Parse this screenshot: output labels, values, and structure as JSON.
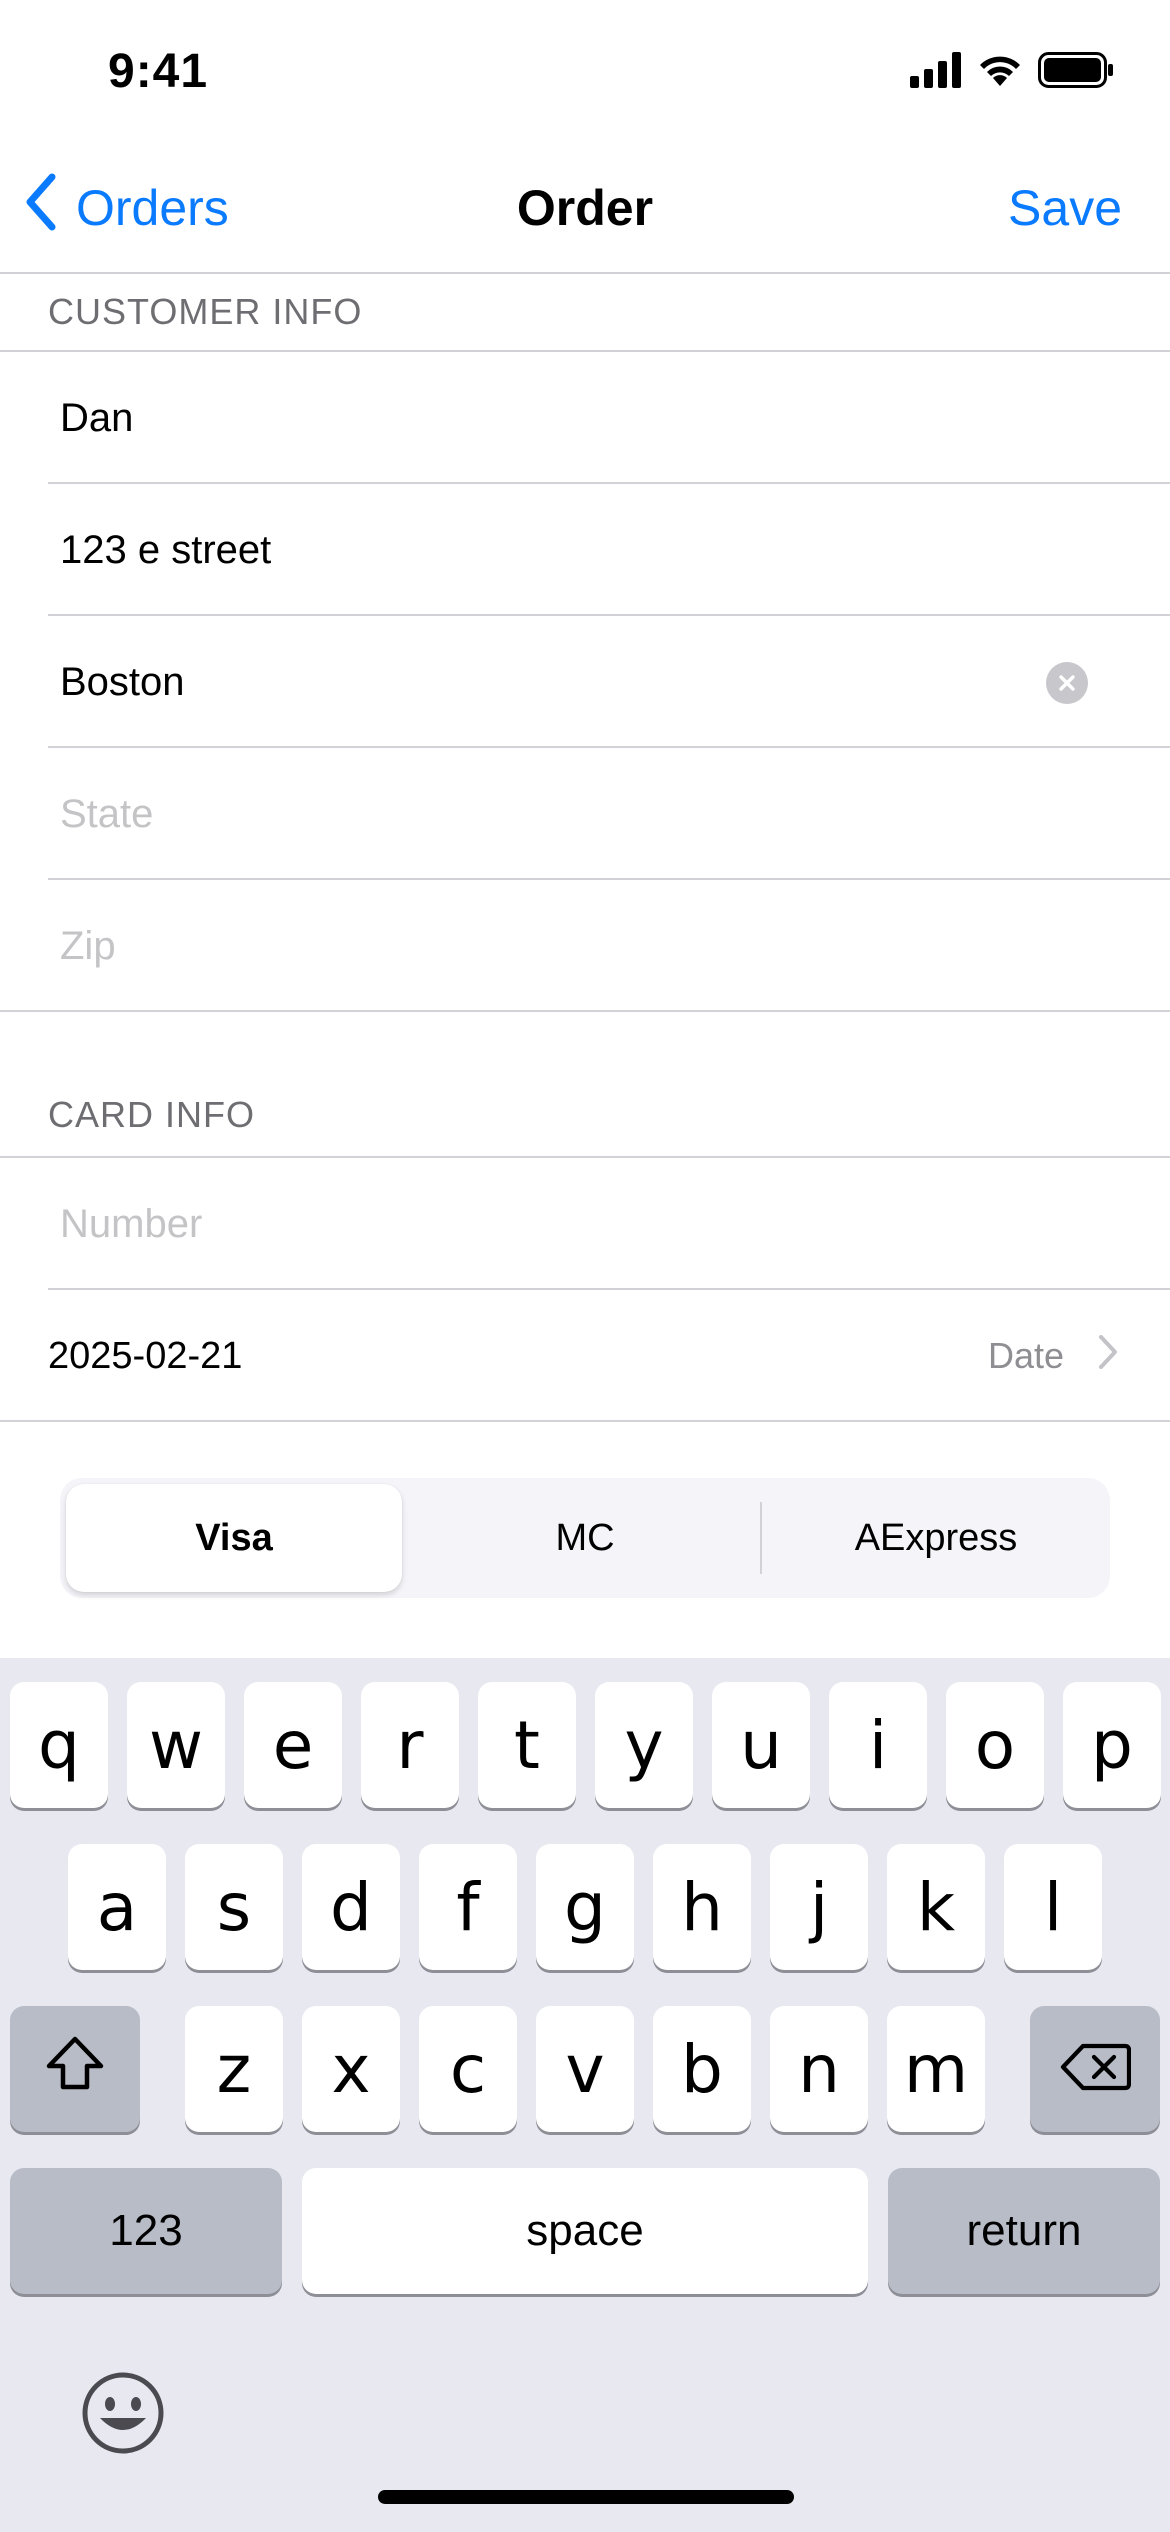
{
  "status_bar": {
    "time": "9:41",
    "icons": [
      "cellular-signal-icon",
      "wifi-icon",
      "battery-icon"
    ]
  },
  "nav": {
    "back_label": "Orders",
    "title": "Order",
    "save_label": "Save"
  },
  "customer_info": {
    "header": "CUSTOMER INFO",
    "name_value": "Dan",
    "address_value": "123 e street",
    "city_value": "Boston",
    "state_placeholder": "State",
    "zip_placeholder": "Zip"
  },
  "card_info": {
    "header": "CARD INFO",
    "number_placeholder": "Number",
    "date_value": "2025-02-21",
    "date_label": "Date"
  },
  "card_type": {
    "options": [
      "Visa",
      "MC",
      "AExpress"
    ],
    "selected": "Visa"
  },
  "keyboard": {
    "row1": [
      "q",
      "w",
      "e",
      "r",
      "t",
      "y",
      "u",
      "i",
      "o",
      "p"
    ],
    "row2": [
      "a",
      "s",
      "d",
      "f",
      "g",
      "h",
      "j",
      "k",
      "l"
    ],
    "row3": [
      "z",
      "x",
      "c",
      "v",
      "b",
      "n",
      "m"
    ],
    "numbers_label": "123",
    "space_label": "space",
    "return_label": "return"
  },
  "colors": {
    "accent": "#0a7aff",
    "separator": "#d1d1d6",
    "keyboard_bg": "#e8e8f0"
  }
}
